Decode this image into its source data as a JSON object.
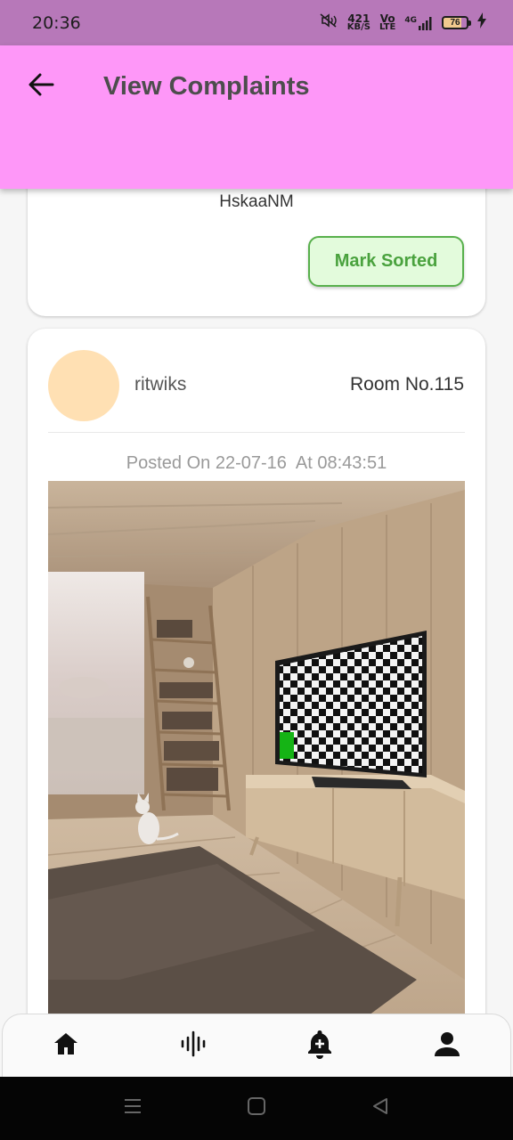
{
  "status_bar": {
    "time": "20:36",
    "net_speed_value": "421",
    "net_speed_unit": "KB/S",
    "volte_top": "Vo",
    "volte_bottom": "LTE",
    "network": "4G",
    "battery": "76"
  },
  "app_bar": {
    "title": "View Complaints",
    "back_icon": "arrow-left-icon",
    "color": "#fe97f8"
  },
  "complaints": [
    {
      "description": "HskaaNM",
      "mark_label": "Mark Sorted"
    },
    {
      "username": "ritwiks",
      "room": "Room No.115",
      "posted_label": "Posted On 22-07-16  At 08:43:51",
      "photo": "room-photo-with-tv-and-cat"
    }
  ],
  "bottom_nav": {
    "items": [
      {
        "icon": "home-icon"
      },
      {
        "icon": "audio-wave-icon"
      },
      {
        "icon": "notification-add-icon"
      },
      {
        "icon": "person-icon"
      }
    ]
  },
  "system_nav": {
    "items": [
      {
        "icon": "recents-icon"
      },
      {
        "icon": "home-square-icon"
      },
      {
        "icon": "back-triangle-icon"
      }
    ]
  },
  "colors": {
    "status_bar": "#b778b9",
    "accent_green": "#4aa23e",
    "avatar": "#ffe0b3"
  }
}
